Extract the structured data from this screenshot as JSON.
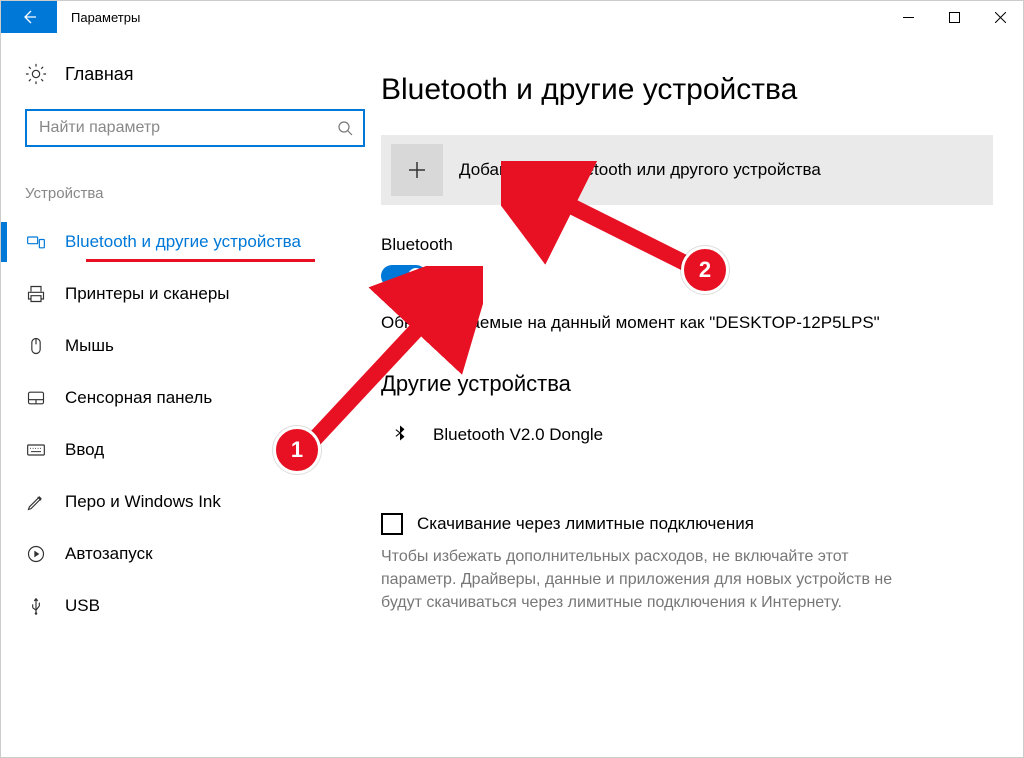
{
  "window": {
    "title": "Параметры"
  },
  "sidebar": {
    "home_label": "Главная",
    "search_placeholder": "Найти параметр",
    "section_title": "Устройства",
    "items": [
      {
        "label": "Bluetooth и другие устройства",
        "icon": "bluetooth-devices-icon",
        "active": true
      },
      {
        "label": "Принтеры и сканеры",
        "icon": "printer-icon",
        "active": false
      },
      {
        "label": "Мышь",
        "icon": "mouse-icon",
        "active": false
      },
      {
        "label": "Сенсорная панель",
        "icon": "touchpad-icon",
        "active": false
      },
      {
        "label": "Ввод",
        "icon": "keyboard-icon",
        "active": false
      },
      {
        "label": "Перо и Windows Ink",
        "icon": "pen-icon",
        "active": false
      },
      {
        "label": "Автозапуск",
        "icon": "autoplay-icon",
        "active": false
      },
      {
        "label": "USB",
        "icon": "usb-icon",
        "active": false
      }
    ]
  },
  "main": {
    "page_title": "Bluetooth и другие устройства",
    "add_device_label": "Добавление Bluetooth или другого устройства",
    "bluetooth_label": "Bluetooth",
    "toggle_state": "Вкл.",
    "discoverable_text": "Обнаруживаемые на данный момент как \"DESKTOP-12P5LPS\"",
    "other_devices_title": "Другие устройства",
    "devices": [
      {
        "name": "Bluetooth V2.0 Dongle"
      }
    ],
    "metered_checkbox_label": "Скачивание через лимитные подключения",
    "metered_hint": "Чтобы избежать дополнительных расходов, не включайте этот параметр. Драйверы, данные и приложения для новых устройств не будут скачиваться через лимитные подключения к Интернету."
  },
  "annotations": {
    "badge1": "1",
    "badge2": "2"
  }
}
